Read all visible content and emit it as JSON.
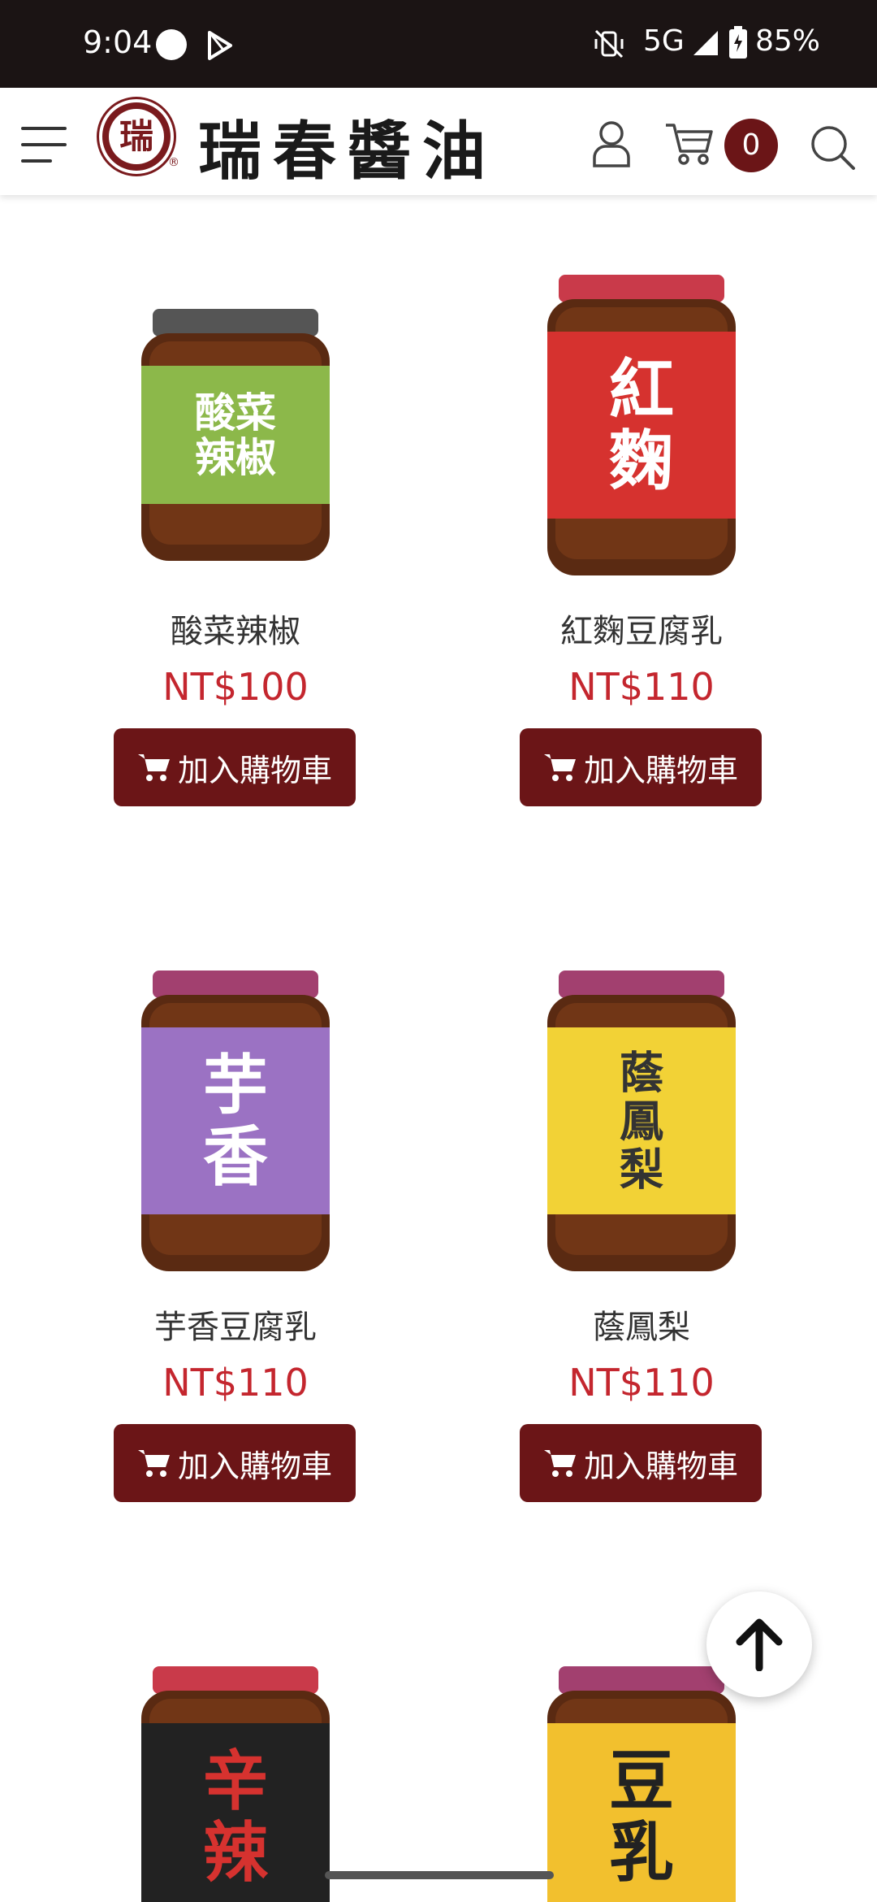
{
  "status_bar": {
    "time": "9:04",
    "network": "5G",
    "battery": "85%"
  },
  "header": {
    "logo_text": "瑞春醬油",
    "logo_seal": "瑞",
    "cart_count": "0"
  },
  "colors": {
    "brand": "#6b1517",
    "price": "#c4262e"
  },
  "products": [
    {
      "name": "酸菜辣椒",
      "price": "NT$100",
      "button": "加入購物車",
      "jar": {
        "label_color": "#8cb84a",
        "lid_color": "#555555",
        "text": "酸菜\n辣椒",
        "text_color": "#ffffff"
      }
    },
    {
      "name": "紅麴豆腐乳",
      "price": "NT$110",
      "button": "加入購物車",
      "jar": {
        "label_color": "#d6322f",
        "lid_color": "#c93a4a",
        "text": "紅\n麴",
        "text_color": "#ffffff"
      }
    },
    {
      "name": "芋香豆腐乳",
      "price": "NT$110",
      "button": "加入購物車",
      "jar": {
        "label_color": "#9b72c3",
        "lid_color": "#a2406f",
        "text": "芋\n香",
        "text_color": "#ffffff"
      }
    },
    {
      "name": "蔭鳳梨",
      "price": "NT$110",
      "button": "加入購物車",
      "jar": {
        "label_color": "#f2d236",
        "lid_color": "#a2406f",
        "text": "蔭\n鳳\n梨",
        "text_color": "#333333"
      }
    },
    {
      "jar": {
        "label_color": "#222222",
        "lid_color": "#c93a4a",
        "text": "辛\n辣",
        "text_color": "#d6322f"
      }
    },
    {
      "jar": {
        "label_color": "#f2c02e",
        "lid_color": "#a2406f",
        "text": "豆\n乳",
        "text_color": "#222222"
      }
    }
  ]
}
